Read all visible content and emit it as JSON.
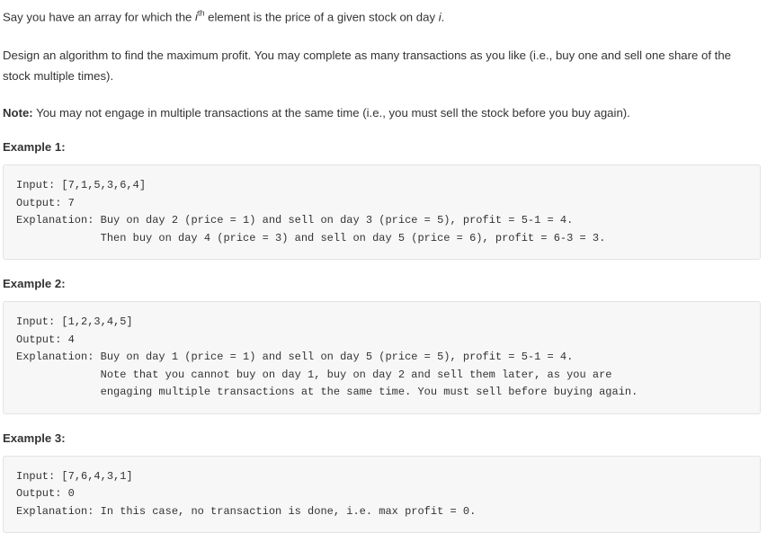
{
  "intro": {
    "paragraph1_before": "Say you have an array for which the ",
    "paragraph1_var": "i",
    "paragraph1_sup": "th",
    "paragraph1_after": " element is the price of a given stock on day ",
    "paragraph1_var2": "i",
    "paragraph1_end": ".",
    "paragraph2": "Design an algorithm to find the maximum profit. You may complete as many transactions as you like (i.e., buy one and sell one share of the stock multiple times).",
    "note_label": "Note:",
    "note_text": " You may not engage in multiple transactions at the same time (i.e., you must sell the stock before you buy again)."
  },
  "examples": [
    {
      "heading": "Example 1:",
      "input_label": "Input:",
      "input_value": " [7,1,5,3,6,4]",
      "output_label": "Output:",
      "output_value": " 7",
      "explanation_label": "Explanation:",
      "explanation_lines": [
        " Buy on day 2 (price = 1) and sell on day 3 (price = 5), profit = 5-1 = 4.",
        "             Then buy on day 4 (price = 3) and sell on day 5 (price = 6), profit = 6-3 = 3."
      ]
    },
    {
      "heading": "Example 2:",
      "input_label": "Input:",
      "input_value": " [1,2,3,4,5]",
      "output_label": "Output:",
      "output_value": " 4",
      "explanation_label": "Explanation:",
      "explanation_lines": [
        " Buy on day 1 (price = 1) and sell on day 5 (price = 5), profit = 5-1 = 4.",
        "             Note that you cannot buy on day 1, buy on day 2 and sell them later, as you are",
        "             engaging multiple transactions at the same time. You must sell before buying again."
      ]
    },
    {
      "heading": "Example 3:",
      "input_label": "Input:",
      "input_value": " [7,6,4,3,1]",
      "output_label": "Output:",
      "output_value": " 0",
      "explanation_label": "Explanation:",
      "explanation_lines": [
        " In this case, no transaction is done, i.e. max profit = 0."
      ]
    }
  ],
  "colors": {
    "text": "#333333",
    "code_background": "#f7f7f7",
    "code_border": "#e3e3e3",
    "page_background": "#ffffff"
  }
}
